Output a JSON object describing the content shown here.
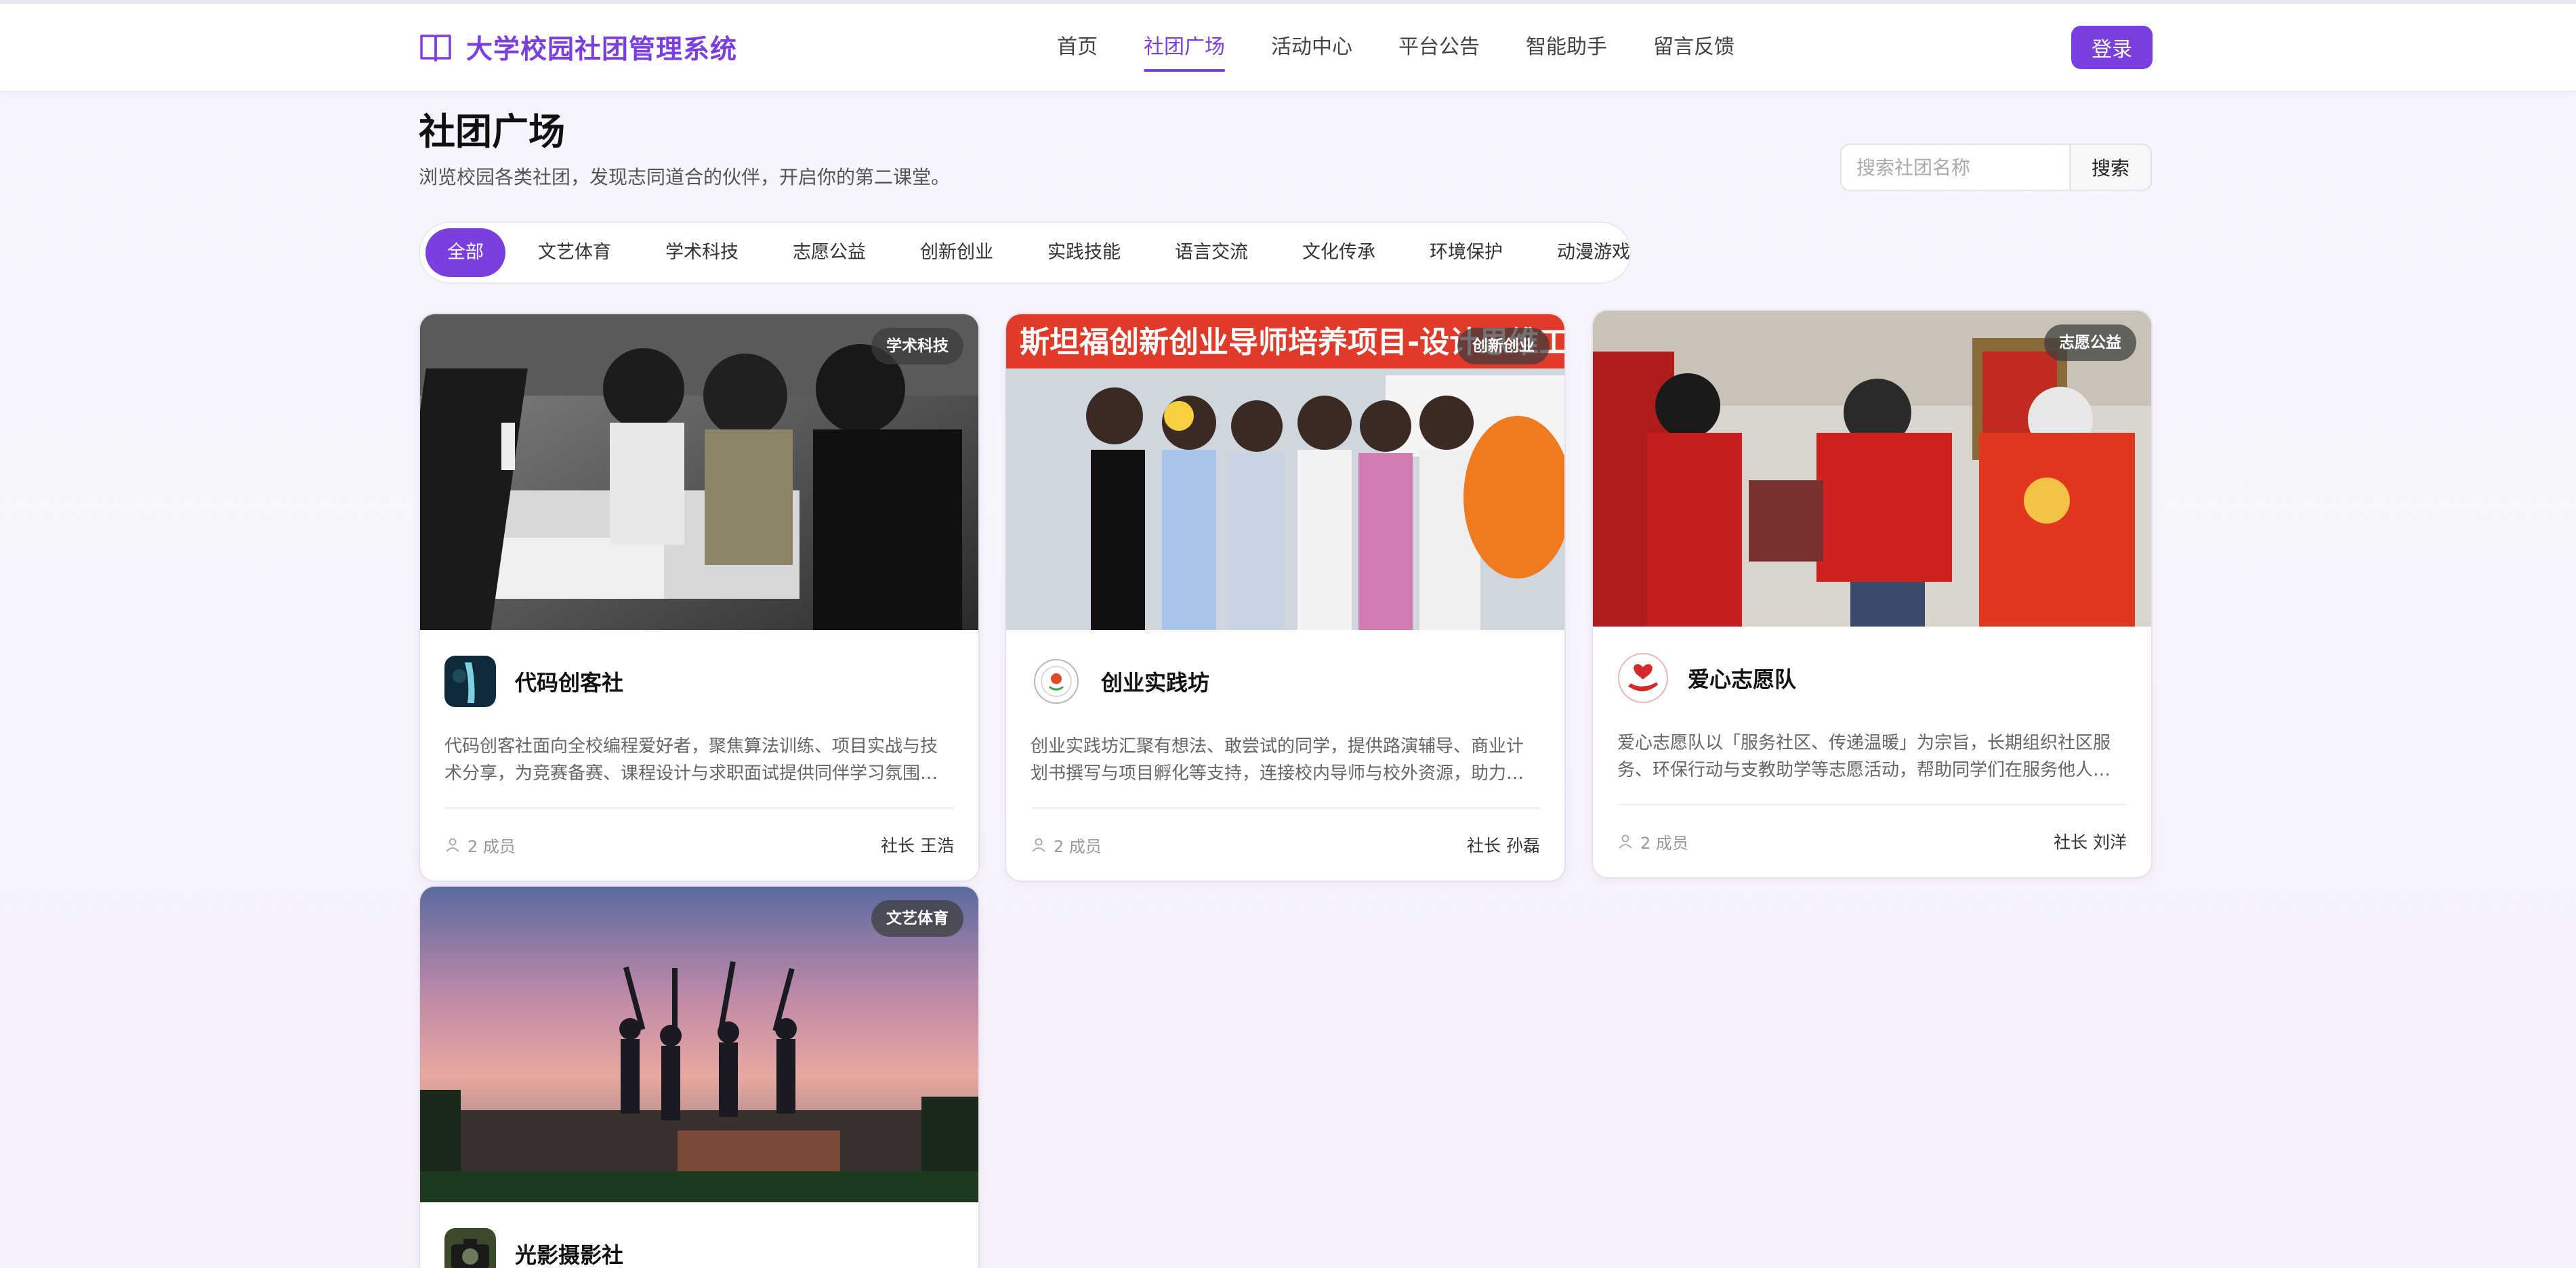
{
  "header": {
    "brand": "大学校园社团管理系统",
    "nav": [
      "首页",
      "社团广场",
      "活动中心",
      "平台公告",
      "智能助手",
      "留言反馈"
    ],
    "active_nav": "社团广场",
    "login_label": "登录"
  },
  "page": {
    "title": "社团广场",
    "subtitle": "浏览校园各类社团，发现志同道合的伙伴，开启你的第二课堂。"
  },
  "search": {
    "placeholder": "搜索社团名称",
    "button_label": "搜索"
  },
  "filters": {
    "items": [
      "全部",
      "文艺体育",
      "学术科技",
      "志愿公益",
      "创新创业",
      "实践技能",
      "语言交流",
      "文化传承",
      "环境保护",
      "动漫游戏"
    ],
    "active": "全部"
  },
  "clubs": [
    {
      "name": "代码创客社",
      "category": "学术科技",
      "description": "代码创客社面向全校编程爱好者，聚焦算法训练、项目实战与技术分享，为竞赛备赛、课程设计与求职面试提供同伴学习氛围…",
      "members": "2 成员",
      "leader": "社长 王浩",
      "logo_icon": "waterfall-logo-icon"
    },
    {
      "name": "创业实践坊",
      "category": "创新创业",
      "description": "创业实践坊汇聚有想法、敢尝试的同学，提供路演辅导、商业计划书撰写与项目孵化等支持，连接校内导师与校外资源，助力…",
      "members": "2 成员",
      "leader": "社长 孙磊",
      "logo_icon": "round-seal-logo-icon",
      "photo_banner": "斯坦福创新创业导师培养项目-设计思维工作坊"
    },
    {
      "name": "爱心志愿队",
      "category": "志愿公益",
      "description": "爱心志愿队以「服务社区、传递温暖」为宗旨，长期组织社区服务、环保行动与支教助学等志愿活动，帮助同学们在服务他人…",
      "members": "2 成员",
      "leader": "社长 刘洋",
      "logo_icon": "heart-hand-logo-icon"
    },
    {
      "name": "光影摄影社",
      "category": "文艺体育",
      "logo_icon": "camera-logo-icon"
    }
  ],
  "colors": {
    "accent": "#7b3fe0",
    "badge_bg": "#3c3c3c"
  }
}
